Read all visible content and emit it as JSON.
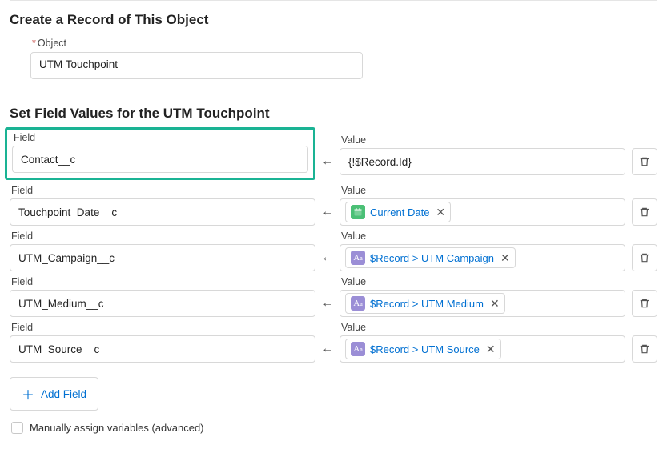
{
  "section1": {
    "title": "Create a Record of This Object",
    "object_label": "Object",
    "object_value": "UTM Touchpoint"
  },
  "section2": {
    "title": "Set Field Values for the UTM Touchpoint",
    "field_label": "Field",
    "value_label": "Value",
    "rows": [
      {
        "field": "Contact__c",
        "value_type": "plain",
        "value_text": "{!$Record.Id}"
      },
      {
        "field": "Touchpoint_Date__c",
        "value_type": "pill",
        "pill_icon": "date",
        "value_text": "Current Date"
      },
      {
        "field": "UTM_Campaign__c",
        "value_type": "pill",
        "pill_icon": "text",
        "value_text": "$Record > UTM Campaign"
      },
      {
        "field": "UTM_Medium__c",
        "value_type": "pill",
        "pill_icon": "text",
        "value_text": "$Record > UTM Medium"
      },
      {
        "field": "UTM_Source__c",
        "value_type": "pill",
        "pill_icon": "text",
        "value_text": "$Record > UTM Source"
      }
    ],
    "add_field_label": "Add Field",
    "manual_assign_label": "Manually assign variables (advanced)"
  }
}
